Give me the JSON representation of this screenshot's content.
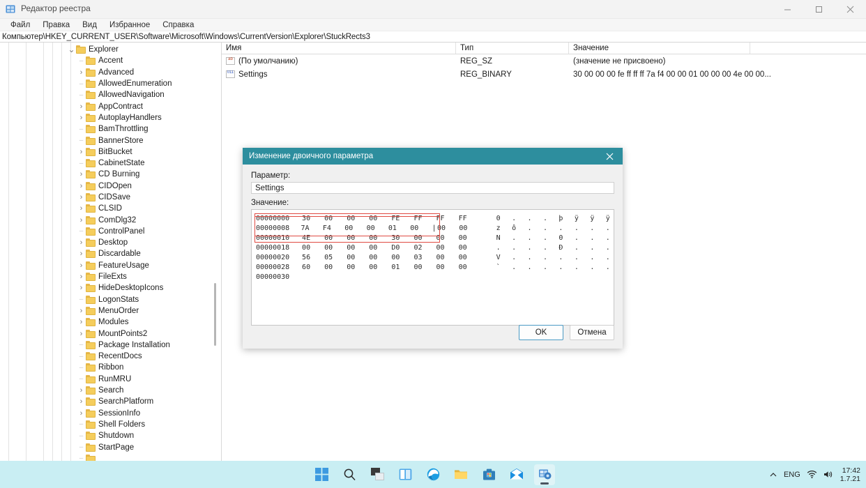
{
  "window": {
    "title": "Редактор реестра",
    "icon": "registry-editor-icon",
    "controls": {
      "minimize": "minimize-icon",
      "maximize": "maximize-icon",
      "close": "close-icon"
    }
  },
  "menu": {
    "items": [
      "Файл",
      "Правка",
      "Вид",
      "Избранное",
      "Справка"
    ]
  },
  "address": {
    "path": "Компьютер\\HKEY_CURRENT_USER\\Software\\Microsoft\\Windows\\CurrentVersion\\Explorer\\StuckRects3"
  },
  "tree": {
    "items": [
      {
        "label": "Explorer",
        "indent": 0,
        "state": "expanded"
      },
      {
        "label": "Accent",
        "indent": 1,
        "state": "leaf"
      },
      {
        "label": "Advanced",
        "indent": 1,
        "state": "collapsed"
      },
      {
        "label": "AllowedEnumeration",
        "indent": 1,
        "state": "leaf"
      },
      {
        "label": "AllowedNavigation",
        "indent": 1,
        "state": "leaf"
      },
      {
        "label": "AppContract",
        "indent": 1,
        "state": "collapsed"
      },
      {
        "label": "AutoplayHandlers",
        "indent": 1,
        "state": "collapsed"
      },
      {
        "label": "BamThrottling",
        "indent": 1,
        "state": "leaf"
      },
      {
        "label": "BannerStore",
        "indent": 1,
        "state": "leaf"
      },
      {
        "label": "BitBucket",
        "indent": 1,
        "state": "collapsed"
      },
      {
        "label": "CabinetState",
        "indent": 1,
        "state": "leaf"
      },
      {
        "label": "CD Burning",
        "indent": 1,
        "state": "collapsed"
      },
      {
        "label": "CIDOpen",
        "indent": 1,
        "state": "collapsed"
      },
      {
        "label": "CIDSave",
        "indent": 1,
        "state": "collapsed"
      },
      {
        "label": "CLSID",
        "indent": 1,
        "state": "collapsed"
      },
      {
        "label": "ComDlg32",
        "indent": 1,
        "state": "collapsed"
      },
      {
        "label": "ControlPanel",
        "indent": 1,
        "state": "leaf"
      },
      {
        "label": "Desktop",
        "indent": 1,
        "state": "collapsed"
      },
      {
        "label": "Discardable",
        "indent": 1,
        "state": "collapsed"
      },
      {
        "label": "FeatureUsage",
        "indent": 1,
        "state": "collapsed"
      },
      {
        "label": "FileExts",
        "indent": 1,
        "state": "collapsed"
      },
      {
        "label": "HideDesktopIcons",
        "indent": 1,
        "state": "collapsed"
      },
      {
        "label": "LogonStats",
        "indent": 1,
        "state": "leaf"
      },
      {
        "label": "MenuOrder",
        "indent": 1,
        "state": "collapsed"
      },
      {
        "label": "Modules",
        "indent": 1,
        "state": "collapsed"
      },
      {
        "label": "MountPoints2",
        "indent": 1,
        "state": "collapsed"
      },
      {
        "label": "Package Installation",
        "indent": 1,
        "state": "leaf"
      },
      {
        "label": "RecentDocs",
        "indent": 1,
        "state": "leaf"
      },
      {
        "label": "Ribbon",
        "indent": 1,
        "state": "leaf"
      },
      {
        "label": "RunMRU",
        "indent": 1,
        "state": "leaf"
      },
      {
        "label": "Search",
        "indent": 1,
        "state": "collapsed"
      },
      {
        "label": "SearchPlatform",
        "indent": 1,
        "state": "collapsed"
      },
      {
        "label": "SessionInfo",
        "indent": 1,
        "state": "collapsed"
      },
      {
        "label": "Shell Folders",
        "indent": 1,
        "state": "leaf"
      },
      {
        "label": "Shutdown",
        "indent": 1,
        "state": "leaf"
      },
      {
        "label": "StartPage",
        "indent": 1,
        "state": "leaf"
      },
      {
        "label": "",
        "indent": 1,
        "state": "leaf"
      }
    ]
  },
  "list": {
    "columns": [
      "Имя",
      "Тип",
      "Значение"
    ],
    "rows": [
      {
        "icon": "string-value-icon",
        "name": "(По умолчанию)",
        "type": "REG_SZ",
        "value": "(значение не присвоено)"
      },
      {
        "icon": "binary-value-icon",
        "name": "Settings",
        "type": "REG_BINARY",
        "value": "30 00 00 00 fe ff ff ff 7a f4 00 00 01 00 00 00 4e 00 00..."
      }
    ]
  },
  "dialog": {
    "title": "Изменение двоичного параметра",
    "close_icon": "close-icon",
    "param_label": "Параметр:",
    "param_value": "Settings",
    "value_label": "Значение:",
    "hex_rows": [
      {
        "offset": "00000000",
        "bytes": [
          "30",
          "00",
          "00",
          "00",
          "FE",
          "FF",
          "FF",
          "FF"
        ],
        "ascii": "0 . . . þ ÿ ÿ ÿ"
      },
      {
        "offset": "00000008",
        "bytes": [
          "7A",
          "F4",
          "00",
          "00",
          "01",
          "00",
          "00",
          "00"
        ],
        "ascii": "z ô . . . . . ."
      },
      {
        "offset": "00000010",
        "bytes": [
          "4E",
          "00",
          "00",
          "00",
          "30",
          "00",
          "00",
          "00"
        ],
        "ascii": "N . . . 0 . . ."
      },
      {
        "offset": "00000018",
        "bytes": [
          "00",
          "00",
          "00",
          "00",
          "D0",
          "02",
          "00",
          "00"
        ],
        "ascii": ". . . . Ð . . ."
      },
      {
        "offset": "00000020",
        "bytes": [
          "56",
          "05",
          "00",
          "00",
          "00",
          "03",
          "00",
          "00"
        ],
        "ascii": "V . . . . . . ."
      },
      {
        "offset": "00000028",
        "bytes": [
          "60",
          "00",
          "00",
          "00",
          "01",
          "00",
          "00",
          "00"
        ],
        "ascii": "` . . . . . . ."
      },
      {
        "offset": "00000030",
        "bytes": [],
        "ascii": ""
      }
    ],
    "caret_row": 1,
    "caret_after_byte": 5,
    "highlight_color": "#e04a42",
    "title_color": "#2d8e9e",
    "ok_label": "OK",
    "cancel_label": "Отмена"
  },
  "taskbar": {
    "icons": [
      "start-icon",
      "search-icon",
      "task-view-icon",
      "widgets-icon",
      "edge-icon",
      "file-explorer-icon",
      "microsoft-store-icon",
      "mail-icon",
      "registry-editor-icon"
    ],
    "active_index": 8,
    "tray": {
      "chevron": "chevron-up-icon",
      "language": "ENG",
      "network": "wifi-icon",
      "volume": "speaker-icon",
      "time": "17:42",
      "date": "1.7.21"
    }
  }
}
